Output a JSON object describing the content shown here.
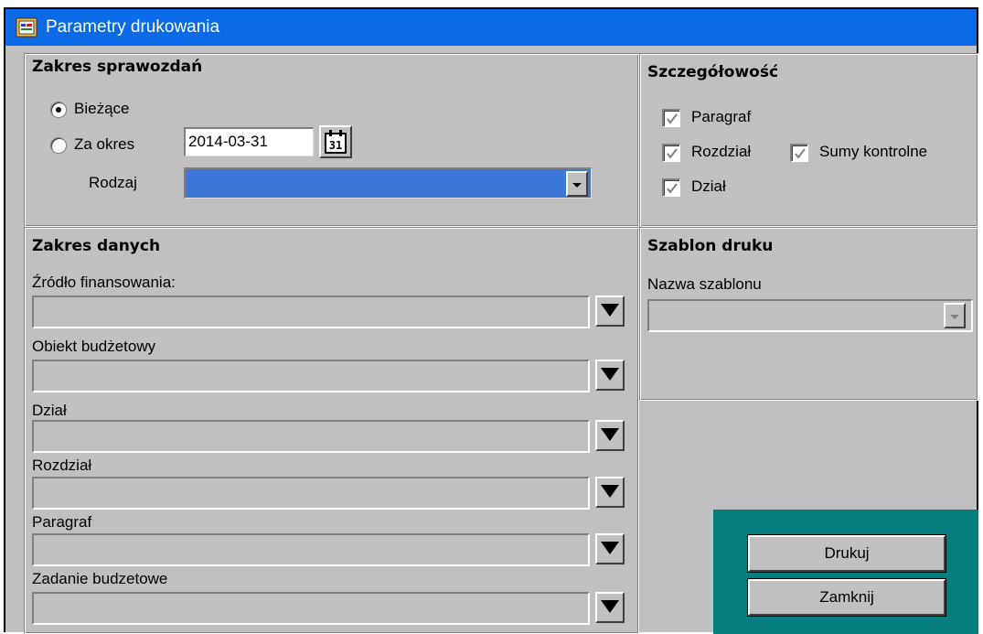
{
  "window": {
    "title": "Parametry drukowania"
  },
  "zakres_sprawozdan": {
    "title": "Zakres sprawozdań",
    "radio_biezace": "Bieżące",
    "radio_za_okres": "Za okres",
    "date_value": "2014-03-31",
    "calendar_day": "31",
    "rodzaj_label": "Rodzaj",
    "rodzaj_value": ""
  },
  "szczegolowosc": {
    "title": "Szczegółowość",
    "paragraf": "Paragraf",
    "rozdzial": "Rozdział",
    "sumy": "Sumy kontrolne",
    "dzial": "Dział"
  },
  "zakres_danych": {
    "title": "Zakres danych",
    "fields": [
      {
        "label": "Źródło finansowania:",
        "value": ""
      },
      {
        "label": "Obiekt budżetowy",
        "value": ""
      },
      {
        "label": "Dział",
        "value": ""
      },
      {
        "label": "Rozdział",
        "value": ""
      },
      {
        "label": "Paragraf",
        "value": ""
      },
      {
        "label": "Zadanie budzetowe",
        "value": ""
      }
    ]
  },
  "szablon": {
    "title": "Szablon druku",
    "label": "Nazwa szablonu",
    "value": ""
  },
  "buttons": {
    "drukuj": "Drukuj",
    "zamknij": "Zamknij"
  },
  "colors": {
    "titlebar": "#0a6ae8",
    "teal": "#067e7e",
    "selection": "#3d78d8"
  }
}
